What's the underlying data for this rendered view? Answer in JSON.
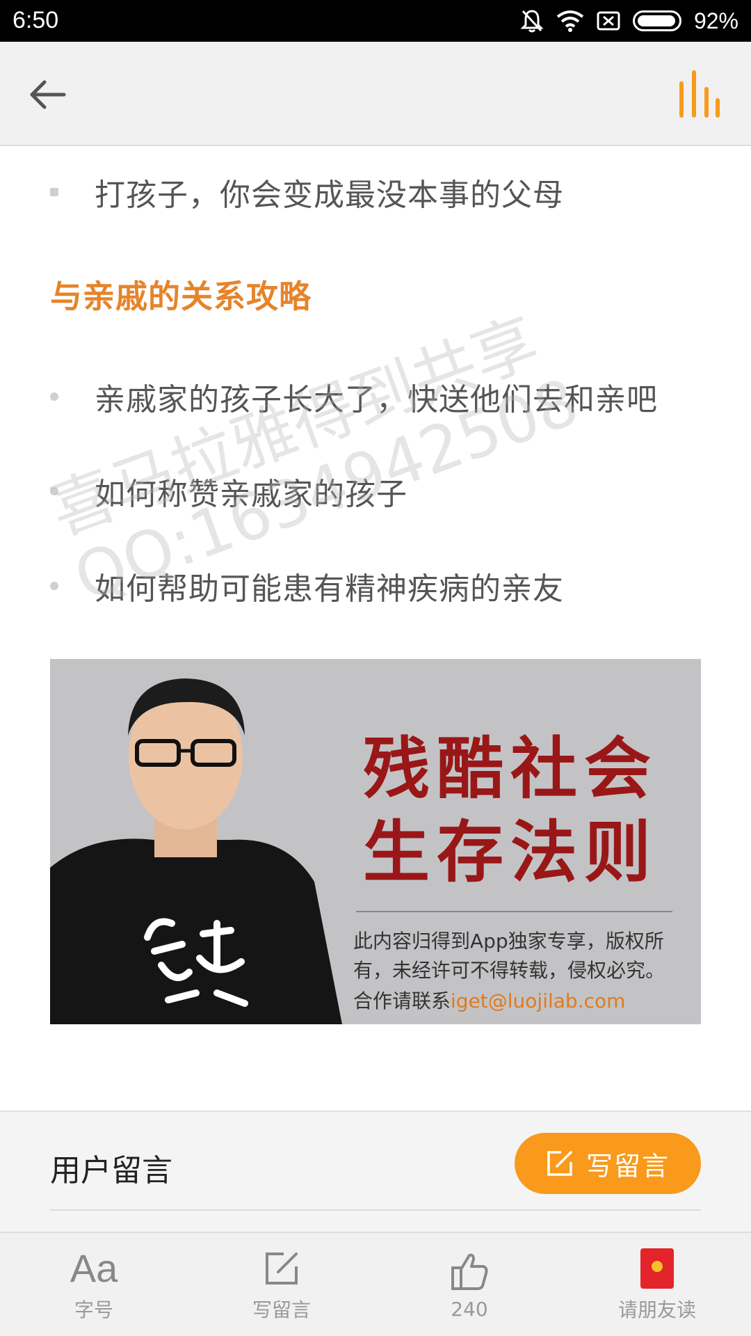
{
  "status_bar": {
    "time": "6:50",
    "battery_percent": "92%",
    "battery_level": 0.92,
    "icons": [
      "bell-off-icon",
      "wifi-icon",
      "sim-off-icon",
      "battery-icon"
    ]
  },
  "app_bar": {
    "back_icon": "arrow-left-icon",
    "audio_icon": "audio-bars-icon",
    "accent_color": "#f99a1c"
  },
  "article": {
    "list_top": [
      "打孩子，你会变成最没本事的父母"
    ],
    "section_title": "与亲戚的关系攻略",
    "section_items": [
      "亲戚家的孩子长大了，快送他们去和亲吧",
      "如何称赞亲戚家的孩子",
      "如何帮助可能患有精神疾病的亲友"
    ],
    "watermark_line1": "喜马拉雅得到共享",
    "watermark_line2": "QQ:1634942508"
  },
  "banner": {
    "title_line1": "残酷社会",
    "title_line2": "生存法则",
    "copyright": "此内容归得到App独家专享，版权所有，未经许可不得转载，侵权必究。",
    "contact_prefix": "合作请联系",
    "contact_email": "iget@luojilab.com",
    "shirt_text": "thought-calligraphy"
  },
  "comments": {
    "label": "用户留言",
    "write_button": "写留言"
  },
  "tab_bar": {
    "items": [
      {
        "label": "字号",
        "glyph": "Aa",
        "icon": "font-size-icon"
      },
      {
        "label": "写留言",
        "icon": "edit-icon"
      },
      {
        "label": "240",
        "icon": "thumbs-up-icon"
      },
      {
        "label": "请朋友读",
        "icon": "red-envelope-icon"
      }
    ]
  }
}
